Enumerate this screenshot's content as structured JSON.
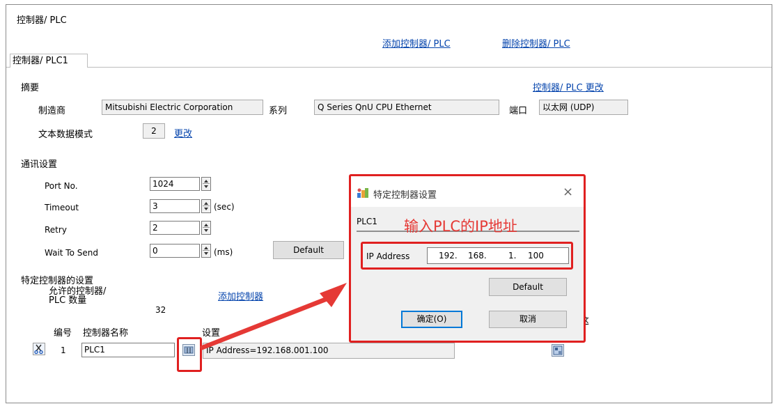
{
  "header": {
    "title": "控制器/ PLC",
    "add_link": "添加控制器/ PLC",
    "delete_link": "删除控制器/ PLC"
  },
  "tab": {
    "label": "控制器/ PLC1"
  },
  "summary": {
    "heading": "摘要",
    "change_link": "控制器/ PLC 更改",
    "manufacturer_label": "制造商",
    "manufacturer_value": "Mitsubishi Electric Corporation",
    "series_label": "系列",
    "series_value": "Q Series QnU CPU Ethernet",
    "port_label": "端口",
    "port_value": "以太网 (UDP)",
    "text_mode_label": "文本数据模式",
    "text_mode_value": "2",
    "text_mode_change": "更改"
  },
  "comm": {
    "heading": "通讯设置",
    "port_label": "Port No.",
    "port_value": "1024",
    "timeout_label": "Timeout",
    "timeout_value": "3",
    "timeout_unit": "(sec)",
    "retry_label": "Retry",
    "retry_value": "2",
    "wait_label": "Wait To Send",
    "wait_value": "0",
    "wait_unit": "(ms)",
    "default_button": "Default"
  },
  "specific": {
    "heading": "特定控制器的设置",
    "allowed_label_line1": "允许的控制器/",
    "allowed_label_line2": "PLC 数量",
    "allowed_value": "32",
    "add_link": "添加控制器",
    "col_number": "编号",
    "col_name": "控制器名称",
    "col_settings": "设置",
    "col_partial": "这",
    "row": {
      "number": "1",
      "name": "PLC1",
      "settings": "IP Address=192.168.001.100"
    }
  },
  "dialog": {
    "title": "特定控制器设置",
    "close": "×",
    "plc_name": "PLC1",
    "annotation": "输入PLC的IP地址",
    "ip_label": "IP Address",
    "ip_octets": [
      "192.",
      "168.",
      "1.",
      "100"
    ],
    "default_button": "Default",
    "ok_button": "确定(O)",
    "cancel_button": "取消"
  },
  "colors": {
    "link": "#0645ad",
    "highlight": "#e02020",
    "annotation_text": "#e53935"
  }
}
